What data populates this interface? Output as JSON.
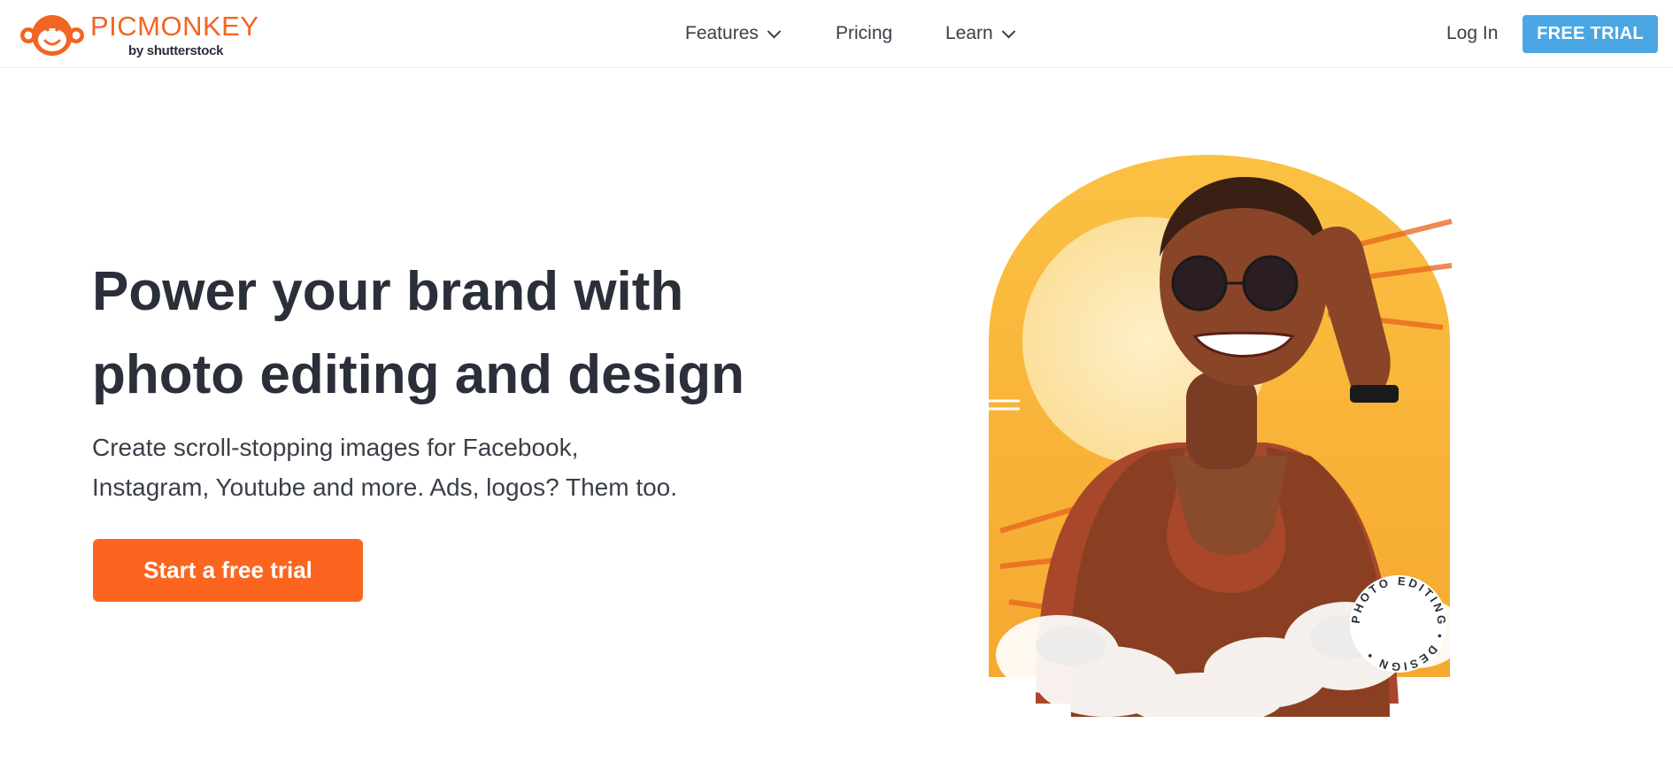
{
  "brand": {
    "name": "PICMONKEY",
    "sub": "by shutterstock",
    "color": "#f26522"
  },
  "nav": {
    "features": "Features",
    "pricing": "Pricing",
    "learn": "Learn",
    "login": "Log In",
    "trial": "FREE TRIAL"
  },
  "hero": {
    "headline_line1": "Power your brand with",
    "headline_line2": "photo editing and design",
    "sub_line1": "Create scroll-stopping images for Facebook,",
    "sub_line2": "Instagram, Youtube and more. Ads, logos? Them too.",
    "cta": "Start a free trial",
    "badge_text": "PHOTO EDITING • DESIGN • "
  },
  "colors": {
    "accent": "#fb6520",
    "nav_button": "#4ba7e3",
    "arch": "#f7b733",
    "text": "#2a2f3a"
  }
}
